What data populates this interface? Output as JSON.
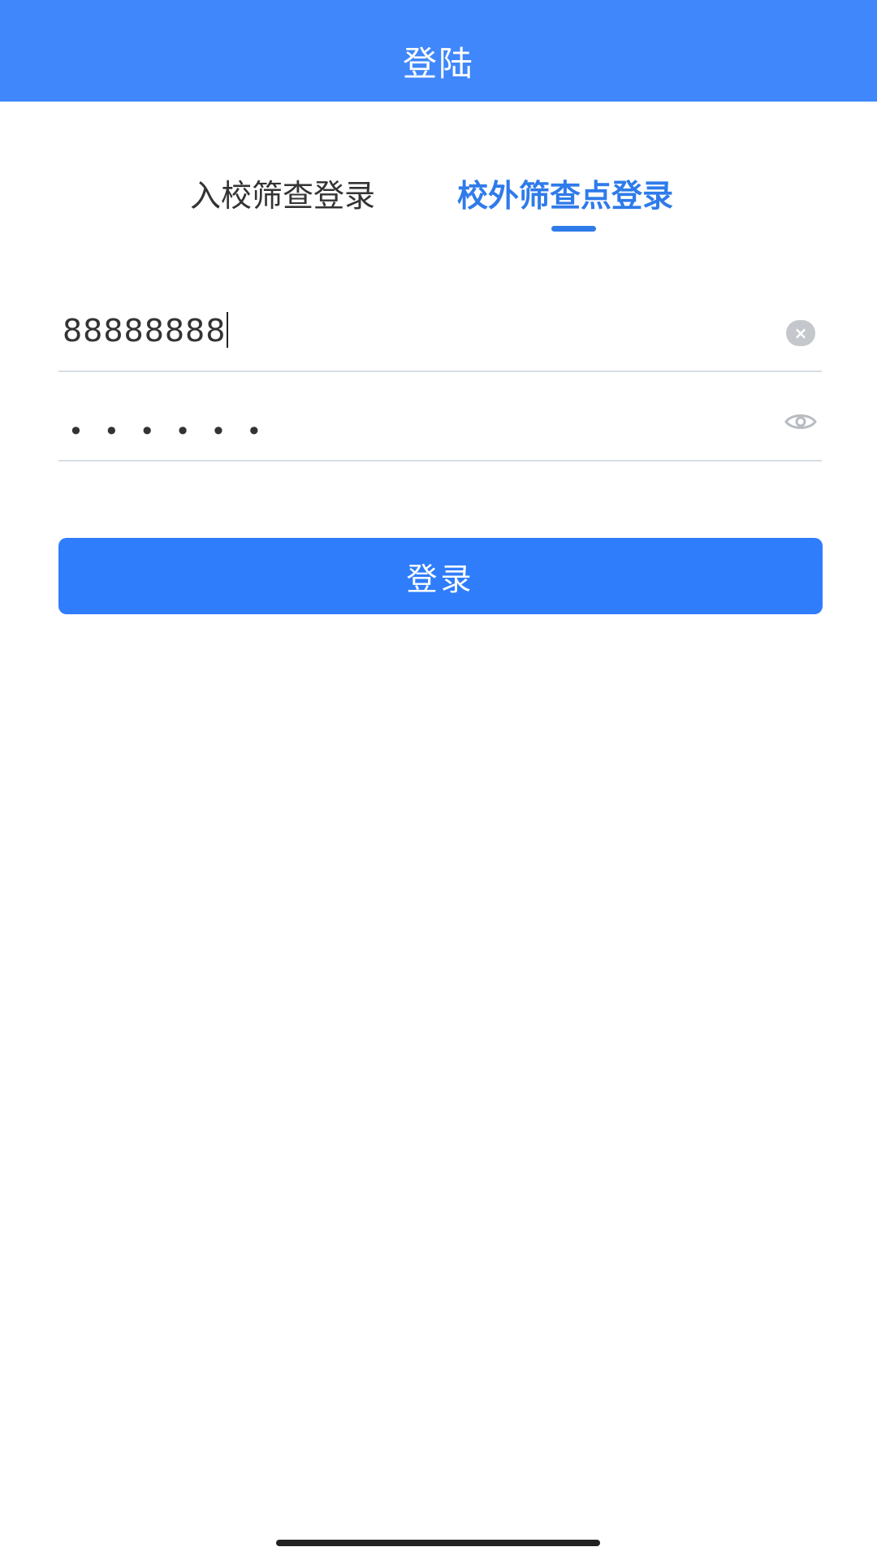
{
  "header": {
    "title": "登陆"
  },
  "tabs": {
    "school_screening": "入校筛查登录",
    "outside_screening_point": "校外筛查点登录",
    "active": "outside_screening_point"
  },
  "form": {
    "account_value": "88888888",
    "password_mask": "••••••",
    "clear_icon": "clear-icon",
    "eye_icon": "eye-icon"
  },
  "login_button": {
    "label": "登录"
  },
  "colors": {
    "header_bg": "#3f87fb",
    "accent": "#2f7bea",
    "button_bg": "#2f7dfb"
  }
}
